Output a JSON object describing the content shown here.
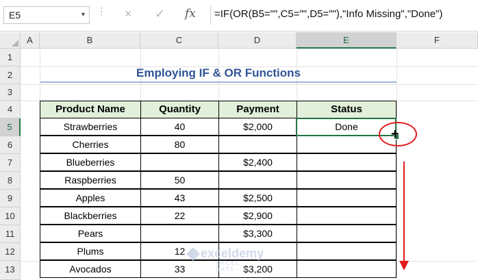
{
  "formula_bar": {
    "name_box": "E5",
    "cancel_icon": "×",
    "enter_icon": "✓",
    "fx_label": "fx",
    "formula": "=IF(OR(B5=\"\",C5=\"\",D5=\"\"),\"Info Missing\",\"Done\")"
  },
  "columns": [
    "A",
    "B",
    "C",
    "D",
    "E",
    "F"
  ],
  "rows": [
    "1",
    "2",
    "3",
    "4",
    "5",
    "6",
    "7",
    "8",
    "9",
    "10",
    "11",
    "12",
    "13"
  ],
  "selected_cell": {
    "column": "E",
    "row": "5"
  },
  "sheet": {
    "title": "Employing IF & OR Functions",
    "headers": [
      "Product Name",
      "Quantity",
      "Payment",
      "Status"
    ],
    "data": [
      [
        "Strawberries",
        "40",
        "$2,000",
        "Done"
      ],
      [
        "Cherries",
        "80",
        "",
        ""
      ],
      [
        "Blueberries",
        "",
        "$2,400",
        ""
      ],
      [
        "Raspberries",
        "50",
        "",
        ""
      ],
      [
        "Apples",
        "43",
        "$2,500",
        ""
      ],
      [
        "Blackberries",
        "22",
        "$2,900",
        ""
      ],
      [
        "Pears",
        "",
        "$3,300",
        ""
      ],
      [
        "Plums",
        "12",
        "",
        ""
      ],
      [
        "Avocados",
        "33",
        "$3,200",
        ""
      ]
    ]
  },
  "watermark": {
    "name": "exceldemy",
    "tagline": "EXCEL · DATA · BI"
  },
  "colors": {
    "accent": "#217346",
    "title": "#2f5496",
    "header_fill": "#e2efda",
    "annotation": "#e21b1b"
  }
}
